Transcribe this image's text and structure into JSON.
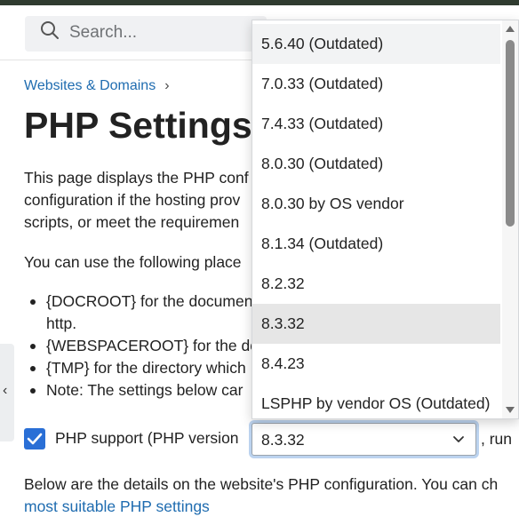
{
  "search": {
    "placeholder": "Search..."
  },
  "breadcrumb": {
    "item": "Websites & Domains",
    "separator": "›"
  },
  "page_title": "PHP Settings f",
  "intro": {
    "line1": "This page displays the PHP conf",
    "line2": "configuration if the hosting prov",
    "line3": "scripts, or meet the requiremen"
  },
  "placeholders_intro": "You can use the following place",
  "placeholders": [
    {
      "line1": "{DOCROOT} for the documen",
      "line2": "http."
    },
    {
      "line1": "{WEBSPACEROOT} for the do"
    },
    {
      "line1": "{TMP} for the directory which"
    },
    {
      "line1": "Note: The settings below car"
    }
  ],
  "php_support": {
    "checked": true,
    "label": "PHP support  (PHP version",
    "selected_version": "8.3.32",
    "after_text": ", run"
  },
  "details": {
    "line": "Below are the details on the website's PHP configuration. You can ch",
    "link": "most suitable PHP settings"
  },
  "php_versions": [
    "5.6.40 (Outdated)",
    "7.0.33 (Outdated)",
    "7.4.33 (Outdated)",
    "8.0.30 (Outdated)",
    "8.0.30 by OS vendor",
    "8.1.34 (Outdated)",
    "8.2.32",
    "8.3.32",
    "8.4.23",
    "LSPHP by vendor OS (Outdated)"
  ],
  "colors": {
    "link": "#1f6cb0",
    "checkbox": "#2a6fd6",
    "focus_ring": "#bcd3ef",
    "selected_option": "#e6e6e6"
  }
}
